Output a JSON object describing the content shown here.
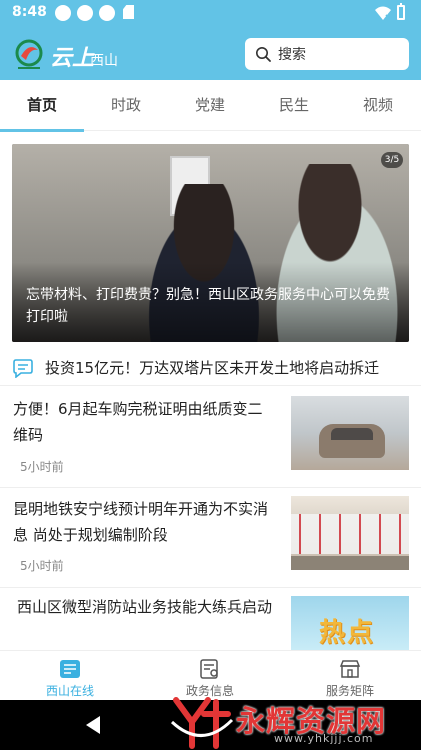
{
  "status_bar": {
    "time": "8:48"
  },
  "header": {
    "brand_primary": "云上",
    "brand_secondary": "西山",
    "search_placeholder": "搜索"
  },
  "tabs": [
    {
      "label": "首页",
      "active": true
    },
    {
      "label": "时政",
      "active": false
    },
    {
      "label": "党建",
      "active": false
    },
    {
      "label": "民生",
      "active": false
    },
    {
      "label": "视频",
      "active": false
    }
  ],
  "hero": {
    "counter": "3/5",
    "caption": "忘带材料、打印费贵？别急！西山区政务服务中心可以免费打印啦"
  },
  "ticker": {
    "icon": "headline-icon",
    "text": "投资15亿元！万达双塔片区未开发土地将启动拆迁"
  },
  "news": [
    {
      "title": "方便！6月起车购完税证明由纸质变二维码",
      "time": "5小时前",
      "thumb": "car-photo"
    },
    {
      "title": "昆明地铁安宁线预计明年开通为不实消息 尚处于规划编制阶段",
      "time": "5小时前",
      "thumb": "metro-photo"
    },
    {
      "title": "西山区微型消防站业务技能大练兵启动",
      "time": "",
      "thumb": "hot-topic-photo",
      "thumb_text": "热点"
    }
  ],
  "bottom_tabs": [
    {
      "label": "西山在线",
      "icon": "news-icon",
      "active": true
    },
    {
      "label": "政务信息",
      "icon": "gov-info-icon",
      "active": false
    },
    {
      "label": "服务矩阵",
      "icon": "service-store-icon",
      "active": false
    }
  ],
  "watermark": {
    "text": "永辉资源网",
    "url": "www.yhkjjj.com"
  },
  "colors": {
    "accent": "#62c3e6",
    "active_tab_text": "#3ab0e0",
    "watermark": "#e23636"
  }
}
